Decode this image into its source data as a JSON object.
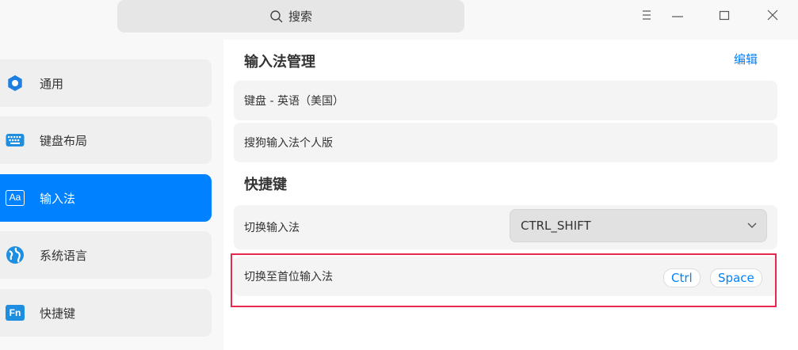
{
  "search": {
    "placeholder": "搜索"
  },
  "window_controls": {
    "menu_icon": "hamburger-icon",
    "minimize_icon": "minimize-icon",
    "maximize_icon": "maximize-icon",
    "close_icon": "close-icon"
  },
  "sidebar": {
    "items": [
      {
        "label": "通用",
        "icon": "gear-icon",
        "active": false
      },
      {
        "label": "键盘布局",
        "icon": "keyboard-icon",
        "active": false
      },
      {
        "label": "输入法",
        "icon": "input-method-icon",
        "active": true,
        "icon_text": "Aa"
      },
      {
        "label": "系统语言",
        "icon": "globe-icon",
        "active": false
      },
      {
        "label": "快捷键",
        "icon": "shortcut-icon",
        "active": false,
        "icon_text": "Fn"
      }
    ]
  },
  "input_methods": {
    "title": "输入法管理",
    "edit_label": "编辑",
    "items": [
      "键盘 - 英语（美国）",
      "搜狗输入法个人版"
    ]
  },
  "shortcuts": {
    "title": "快捷键",
    "switch": {
      "label": "切换输入法",
      "value": "CTRL_SHIFT"
    },
    "first": {
      "label": "切换至首位输入法",
      "keys": [
        "Ctrl",
        "Space"
      ]
    }
  },
  "colors": {
    "accent": "#0081ff",
    "highlight": "#e8294f",
    "sidebar_bg": "#efefef",
    "row_bg": "#f4f4f4"
  }
}
